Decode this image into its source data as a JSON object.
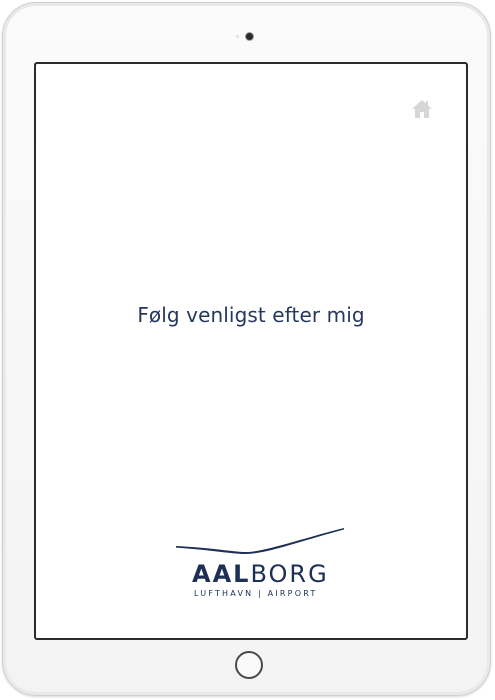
{
  "screen": {
    "message": "Følg venligst efter mig"
  },
  "icons": {
    "home": "home-icon"
  },
  "logo": {
    "main_bold": "AAL",
    "main_light": "BORG",
    "subtitle": "LUFTHAVN | AIRPORT"
  },
  "colors": {
    "brand_navy": "#1d2f56",
    "message_text": "#25395e",
    "home_icon_gray": "#d6d6d6"
  }
}
